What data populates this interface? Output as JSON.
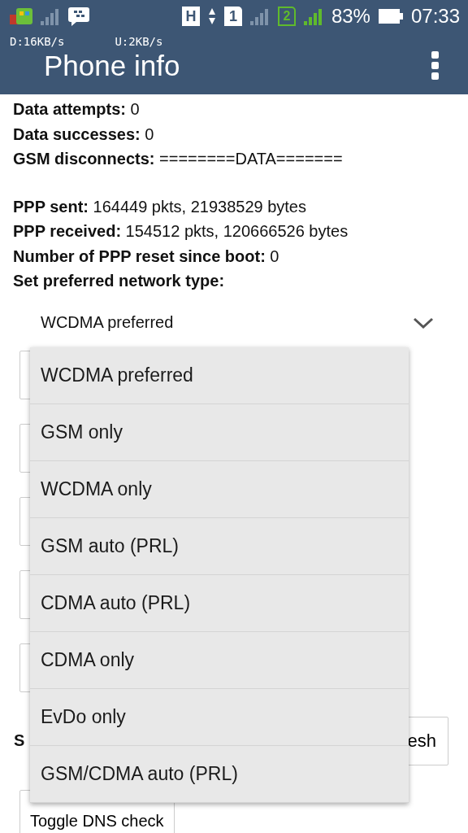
{
  "status_bar": {
    "network_type": "H",
    "sim_1": "1",
    "sim_2": "2",
    "battery": "83%",
    "time": "07:33",
    "download_speed": "D:16KB/s",
    "upload_speed": "U:2KB/s"
  },
  "app_bar": {
    "title": "Phone info"
  },
  "info_lines": [
    {
      "text": "**Data attempts:** 0"
    },
    {
      "text": "**Data successes:** 0"
    },
    {
      "text": "**GSM disconnects:** ========DATA======="
    },
    {
      "text": "**PPP sent:** 164449 pkts, 21938529 bytes"
    },
    {
      "text": "**PPP received:** 154512 pkts, 120666526 bytes"
    },
    {
      "text": "**Number of PPP reset since boot:** 0"
    },
    {
      "text": "**Set preferred network type:**"
    }
  ],
  "network_spinner": {
    "value": "WCDMA preferred"
  },
  "smsc_label": "S",
  "refresh_button": "esh",
  "dns_button": "Toggle DNS check",
  "dropdown": {
    "options": [
      "WCDMA preferred",
      "GSM only",
      "WCDMA only",
      "GSM auto (PRL)",
      "CDMA auto (PRL)",
      "CDMA only",
      "EvDo only",
      "GSM/CDMA auto (PRL)"
    ]
  }
}
